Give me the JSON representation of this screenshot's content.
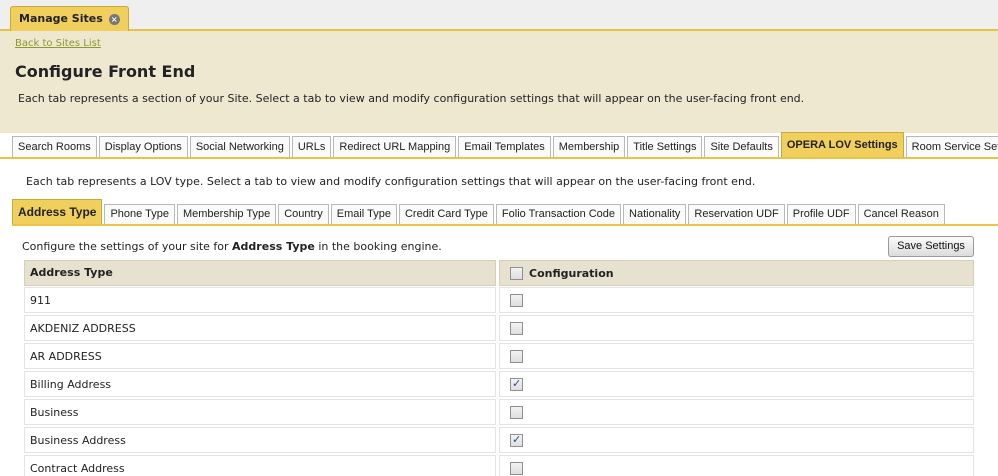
{
  "top_tab": {
    "label": "Manage Sites"
  },
  "header": {
    "back_link": "Back to Sites List",
    "title": "Configure Front End",
    "description": "Each tab represents a section of your Site. Select a tab to view and modify configuration settings that will appear on the user-facing front end."
  },
  "main_tabs": [
    {
      "label": "Search Rooms",
      "active": false
    },
    {
      "label": "Display Options",
      "active": false
    },
    {
      "label": "Social Networking",
      "active": false
    },
    {
      "label": "URLs",
      "active": false
    },
    {
      "label": "Redirect URL Mapping",
      "active": false
    },
    {
      "label": "Email Templates",
      "active": false
    },
    {
      "label": "Membership",
      "active": false
    },
    {
      "label": "Title Settings",
      "active": false
    },
    {
      "label": "Site Defaults",
      "active": false
    },
    {
      "label": "OPERA LOV Settings",
      "active": true
    },
    {
      "label": "Room Service Settings",
      "active": false
    }
  ],
  "lov_description": "Each tab represents a LOV type. Select a tab to view and modify configuration settings that will appear on the user-facing front end.",
  "sub_tabs": [
    {
      "label": "Address Type",
      "active": true
    },
    {
      "label": "Phone Type",
      "active": false
    },
    {
      "label": "Membership Type",
      "active": false
    },
    {
      "label": "Country",
      "active": false
    },
    {
      "label": "Email Type",
      "active": false
    },
    {
      "label": "Credit Card Type",
      "active": false
    },
    {
      "label": "Folio Transaction Code",
      "active": false
    },
    {
      "label": "Nationality",
      "active": false
    },
    {
      "label": "Reservation UDF",
      "active": false
    },
    {
      "label": "Profile UDF",
      "active": false
    },
    {
      "label": "Cancel Reason",
      "active": false
    }
  ],
  "config": {
    "prefix": "Configure the settings of your site for ",
    "type": "Address Type",
    "suffix": " in the booking engine.",
    "save_label": "Save Settings"
  },
  "table": {
    "col_type": "Address Type",
    "col_config": "Configuration",
    "header_checked": false,
    "rows": [
      {
        "name": "911",
        "checked": false
      },
      {
        "name": "AKDENIZ ADDRESS",
        "checked": false
      },
      {
        "name": "AR ADDRESS",
        "checked": false
      },
      {
        "name": "Billing Address",
        "checked": true
      },
      {
        "name": "Business",
        "checked": false
      },
      {
        "name": "Business Address",
        "checked": true
      },
      {
        "name": "Contract Address",
        "checked": false
      }
    ]
  }
}
